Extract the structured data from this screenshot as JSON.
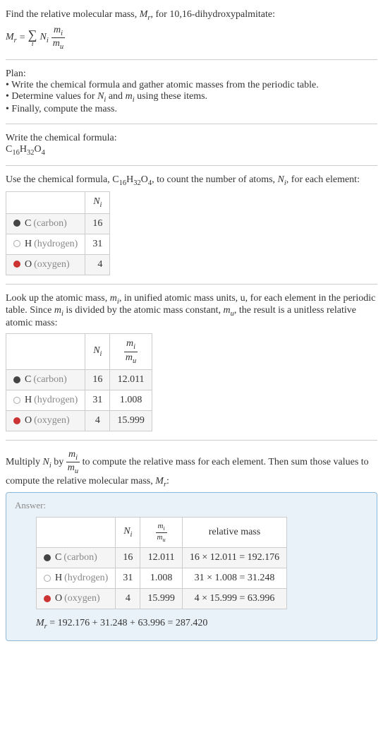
{
  "intro": {
    "line1_pre": "Find the relative molecular mass, ",
    "line1_var": "M",
    "line1_varsub": "r",
    "line1_post": ", for 10,16-dihydroxypalmitate:"
  },
  "eq1": {
    "lhs_var": "M",
    "lhs_sub": "r",
    "equals": " = ",
    "N": "N",
    "i": "i",
    "m": "m",
    "u": "u"
  },
  "plan": {
    "title": "Plan:",
    "b1": "• Write the chemical formula and gather atomic masses from the periodic table.",
    "b2_pre": "• Determine values for ",
    "b2_mid": " and ",
    "b2_post": " using these items.",
    "b3": "• Finally, compute the mass."
  },
  "chemformula": {
    "title": "Write the chemical formula:",
    "C": "C",
    "Cn": "16",
    "H": "H",
    "Hn": "32",
    "O": "O",
    "On": "4"
  },
  "count": {
    "pre": "Use the chemical formula, ",
    "post_pre": ", to count the number of atoms, ",
    "post_post": ", for each element:"
  },
  "table1": {
    "header_Ni": "N",
    "header_Ni_sub": "i",
    "rows": [
      {
        "dot": "dot-c",
        "sym": "C",
        "name": "(carbon)",
        "n": "16"
      },
      {
        "dot": "dot-h",
        "sym": "H",
        "name": "(hydrogen)",
        "n": "31"
      },
      {
        "dot": "dot-o",
        "sym": "O",
        "name": "(oxygen)",
        "n": "4"
      }
    ]
  },
  "lookup": {
    "l1": "Look up the atomic mass, ",
    "l2": ", in unified atomic mass units, u, for each element in the periodic table. Since ",
    "l3": " is divided by the atomic mass constant, ",
    "l4": ", the result is a unitless relative atomic mass:"
  },
  "table2": {
    "rows": [
      {
        "dot": "dot-c",
        "sym": "C",
        "name": "(carbon)",
        "n": "16",
        "mass": "12.011"
      },
      {
        "dot": "dot-h",
        "sym": "H",
        "name": "(hydrogen)",
        "n": "31",
        "mass": "1.008"
      },
      {
        "dot": "dot-o",
        "sym": "O",
        "name": "(oxygen)",
        "n": "4",
        "mass": "15.999"
      }
    ]
  },
  "multiply": {
    "pre": "Multiply ",
    "mid1": " by ",
    "mid2": " to compute the relative mass for each element. Then sum those values to compute the relative molecular mass, ",
    "post": ":"
  },
  "answer": {
    "label": "Answer:",
    "relmass_header": "relative mass",
    "rows": [
      {
        "dot": "dot-c",
        "sym": "C",
        "name": "(carbon)",
        "n": "16",
        "mass": "12.011",
        "calc": "16 × 12.011 = 192.176"
      },
      {
        "dot": "dot-h",
        "sym": "H",
        "name": "(hydrogen)",
        "n": "31",
        "mass": "1.008",
        "calc": "31 × 1.008 = 31.248"
      },
      {
        "dot": "dot-o",
        "sym": "O",
        "name": "(oxygen)",
        "n": "4",
        "mass": "15.999",
        "calc": "4 × 15.999 = 63.996"
      }
    ],
    "final": " = 192.176 + 31.248 + 63.996 = 287.420"
  }
}
